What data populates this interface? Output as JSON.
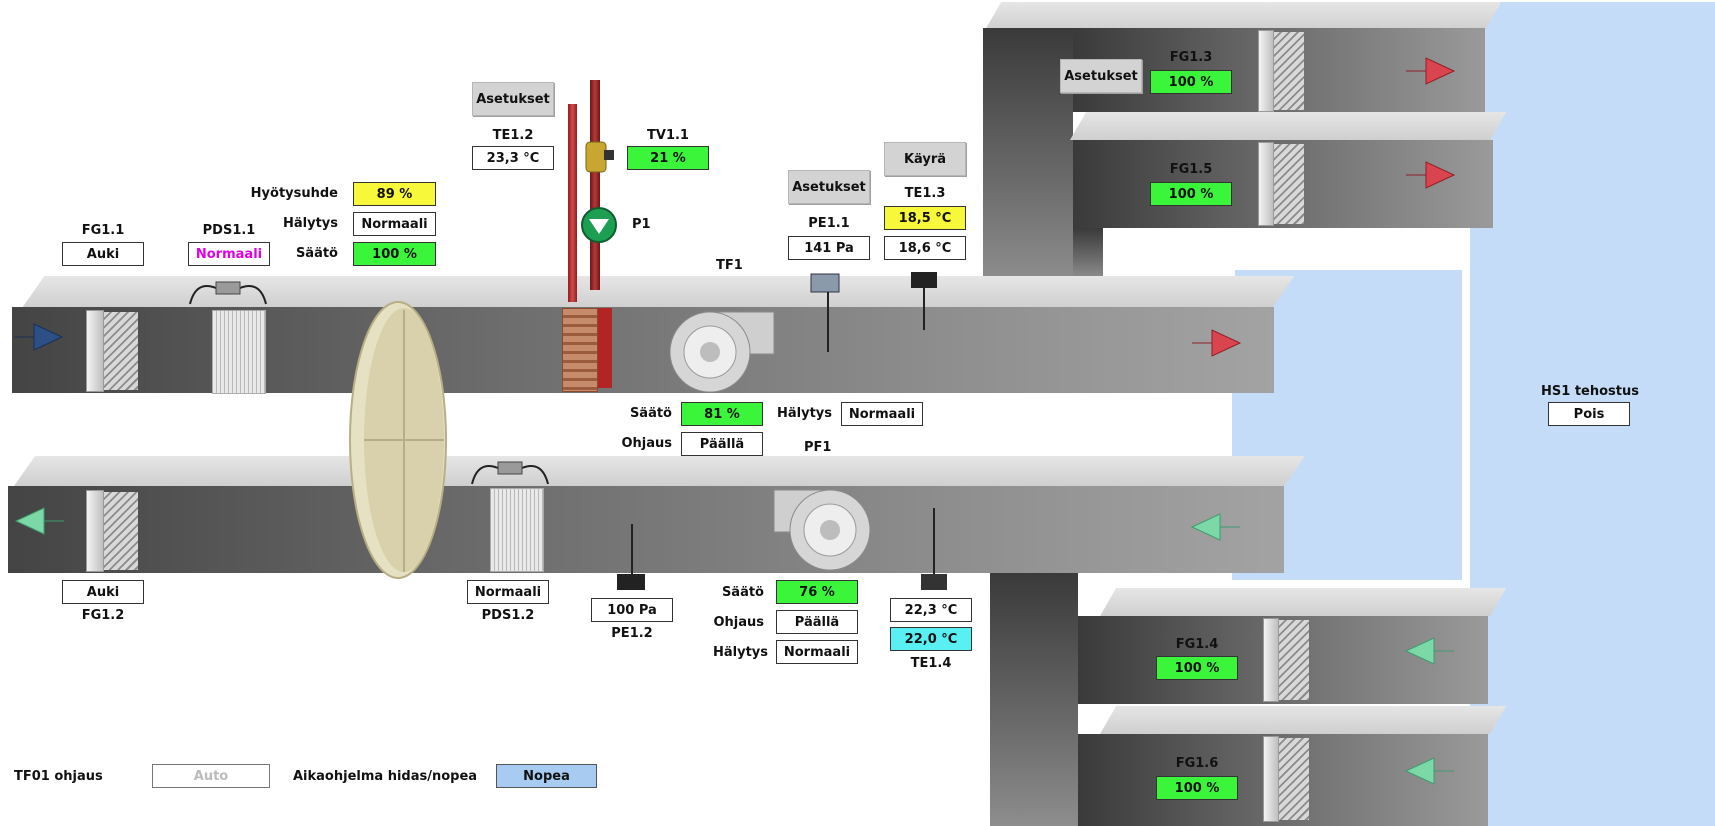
{
  "supply": {
    "fg11": {
      "label": "FG1.1",
      "value": "Auki"
    },
    "pds11": {
      "label": "PDS1.1",
      "value": "Normaali"
    },
    "heat_recovery": {
      "efficiency_label": "Hyötysuhde",
      "efficiency_value": "89 %",
      "alarm_label": "Hälytys",
      "alarm_value": "Normaali",
      "control_label": "Säätö",
      "control_value": "100 %"
    },
    "settings_btn_1": "Asetukset",
    "te12": {
      "label": "TE1.2",
      "value": "23,3 °C"
    },
    "tv11": {
      "label": "TV1.1",
      "value": "21 %"
    },
    "p1": {
      "label": "P1"
    },
    "settings_btn_2": "Asetukset",
    "pe11": {
      "label": "PE1.1",
      "value": "141 Pa"
    },
    "curve_btn": "Käyrä",
    "te13": {
      "label": "TE1.3",
      "value_setpoint": "18,5 °C",
      "value_actual": "18,6 °C"
    },
    "tf1": {
      "label": "TF1",
      "control_label": "Säätö",
      "control_value": "81 %",
      "cmd_label": "Ohjaus",
      "cmd_value": "Päällä",
      "alarm_label": "Hälytys",
      "alarm_value": "Normaali"
    }
  },
  "branches": {
    "settings_btn": "Asetukset",
    "fg13": {
      "label": "FG1.3",
      "value": "100 %"
    },
    "fg15": {
      "label": "FG1.5",
      "value": "100 %"
    },
    "fg14": {
      "label": "FG1.4",
      "value": "100 %"
    },
    "fg16": {
      "label": "FG1.6",
      "value": "100 %"
    }
  },
  "exhaust": {
    "fg12": {
      "label": "FG1.2",
      "value": "Auki"
    },
    "pds12": {
      "label": "PDS1.2",
      "value": "Normaali"
    },
    "pe12": {
      "label": "PE1.2",
      "value": "100 Pa"
    },
    "pf1": {
      "label": "PF1",
      "control_label": "Säätö",
      "control_value": "76 %",
      "cmd_label": "Ohjaus",
      "cmd_value": "Päällä",
      "alarm_label": "Hälytys",
      "alarm_value": "Normaali"
    },
    "te14": {
      "label": "TE1.4",
      "value_actual": "22,3 °C",
      "value_setpoint": "22,0 °C"
    }
  },
  "hs1": {
    "label": "HS1 tehostus",
    "value": "Pois"
  },
  "footer": {
    "tf01_label": "TF01 ohjaus",
    "tf01_value": "Auto",
    "schedule_label": "Aikaohjelma hidas/nopea",
    "schedule_value": "Nopea"
  },
  "colors": {
    "green": "#3af53a",
    "yellow": "#f8f83a",
    "cyan": "#58f0f3",
    "zone_blue": "#c5dcf8",
    "supply_arrow": "#d9454f",
    "exhaust_arrow": "#7dd8a8",
    "intake_arrow": "#2c4f86"
  },
  "icons": [
    "intake-arrow-icon",
    "supply-arrow-icon",
    "exhaust-arrow-icon",
    "pump-icon",
    "valve-icon",
    "pressure-sensor-icon",
    "temperature-sensor-icon",
    "fan-icon",
    "rotary-heat-exchanger-icon"
  ]
}
